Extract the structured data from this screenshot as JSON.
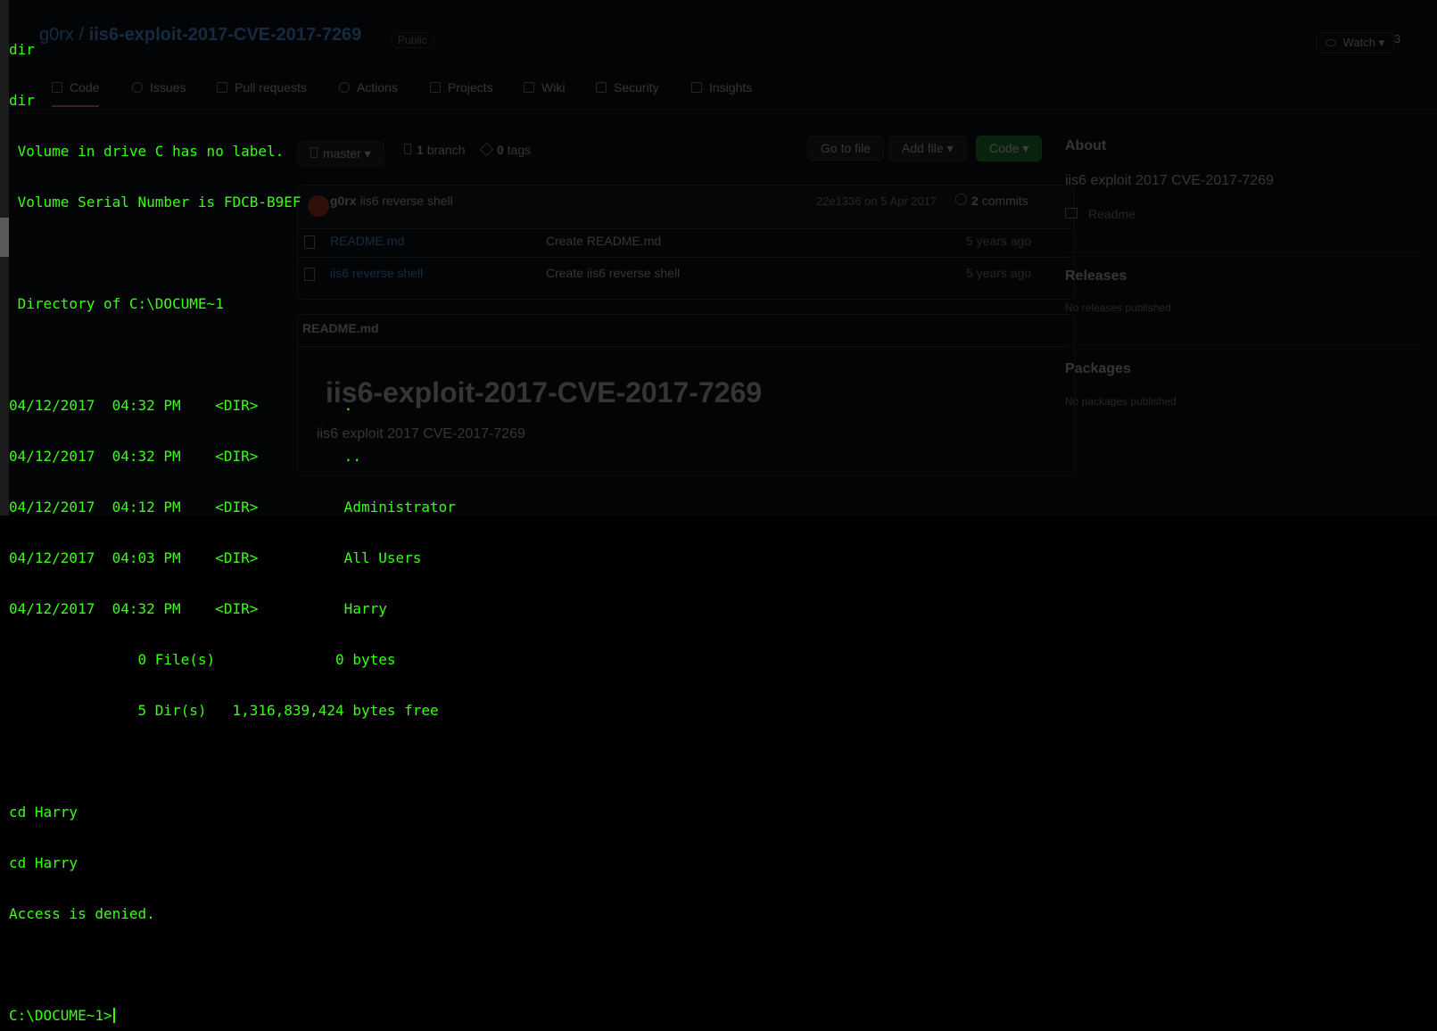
{
  "background_page": {
    "owner": "g0rx",
    "repo": "iis6-exploit-2017-CVE-2017-7269",
    "visibility": "Public",
    "watch_label": "Watch",
    "watch_count": "3",
    "tabs": [
      "Code",
      "Issues",
      "Pull requests",
      "Actions",
      "Projects",
      "Wiki",
      "Security",
      "Insights"
    ],
    "branch": "master",
    "branches_count": "1",
    "branches_label": "branch",
    "tags_count": "0",
    "tags_label": "tags",
    "go_to_file": "Go to file",
    "add_file": "Add file",
    "code_button": "Code",
    "last_commit": {
      "author": "g0rx",
      "message": "iis6 reverse shell",
      "hash": "22e1336",
      "date": "on 5 Apr 2017",
      "commits_count": "2",
      "commits_label": "commits"
    },
    "files": [
      {
        "name": "README.md",
        "message": "Create README.md",
        "age": "5 years ago"
      },
      {
        "name": "iis6 reverse shell",
        "message": "Create iis6 reverse shell",
        "age": "5 years ago"
      }
    ],
    "readme": {
      "header": "README.md",
      "title": "iis6-exploit-2017-CVE-2017-7269",
      "body": "iis6 exploit 2017 CVE-2017-7269"
    },
    "sidebar": {
      "about_heading": "About",
      "about_text": "iis6 exploit 2017 CVE-2017-7269",
      "readme_link": "Readme",
      "releases_heading": "Releases",
      "releases_text": "No releases published",
      "packages_heading": "Packages",
      "packages_text": "No packages published"
    }
  },
  "terminal": {
    "lines": [
      "dir",
      "dir",
      " Volume in drive C has no label.",
      " Volume Serial Number is FDCB-B9EF",
      "",
      " Directory of C:\\DOCUME~1",
      "",
      "04/12/2017  04:32 PM    <DIR>          .",
      "04/12/2017  04:32 PM    <DIR>          ..",
      "04/12/2017  04:12 PM    <DIR>          Administrator",
      "04/12/2017  04:03 PM    <DIR>          All Users",
      "04/12/2017  04:32 PM    <DIR>          Harry",
      "               0 File(s)              0 bytes",
      "               5 Dir(s)   1,316,839,424 bytes free",
      "",
      "cd Harry",
      "cd Harry",
      "Access is denied.",
      ""
    ],
    "prompt": "C:\\DOCUME~1>",
    "text_color": "#39ff14",
    "background_color": "#000000"
  }
}
